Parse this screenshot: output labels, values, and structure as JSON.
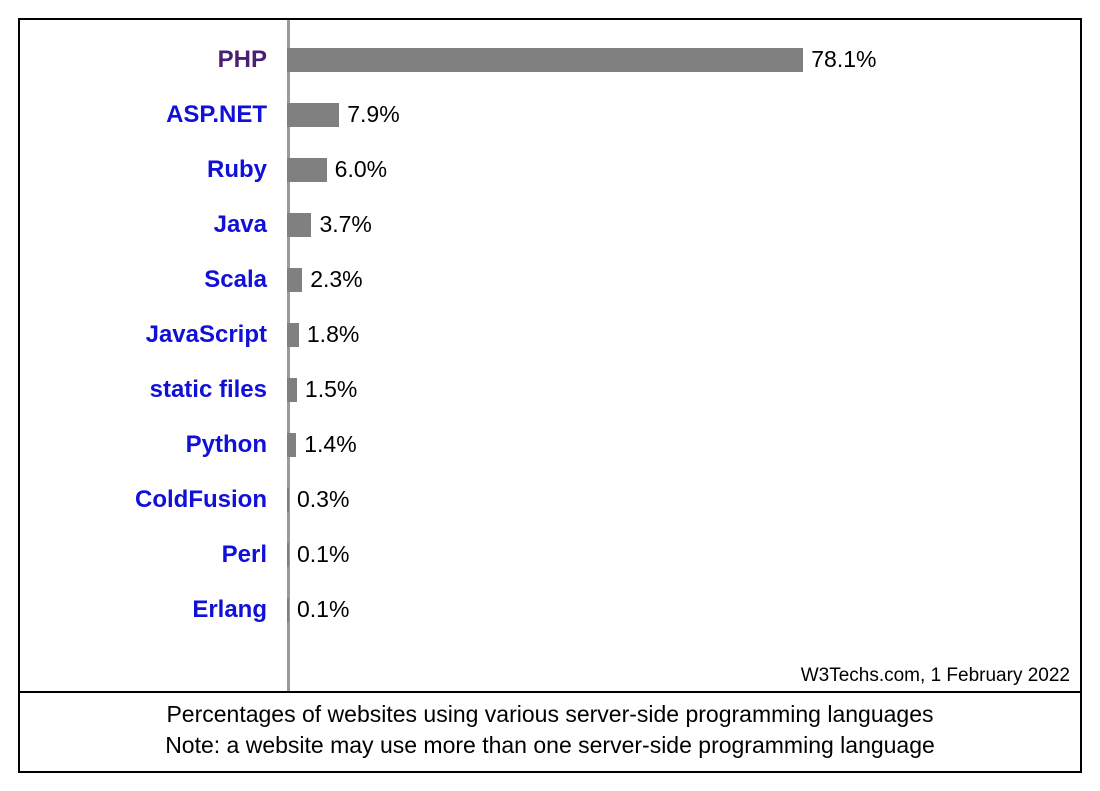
{
  "chart_data": {
    "type": "bar",
    "orientation": "horizontal",
    "categories": [
      "PHP",
      "ASP.NET",
      "Ruby",
      "Java",
      "Scala",
      "JavaScript",
      "static files",
      "Python",
      "ColdFusion",
      "Perl",
      "Erlang"
    ],
    "values": [
      78.1,
      7.9,
      6.0,
      3.7,
      2.3,
      1.8,
      1.5,
      1.4,
      0.3,
      0.1,
      0.1
    ],
    "value_suffix": "%",
    "xlim": [
      0,
      100
    ],
    "highlighted_index": 0,
    "bar_color": "#808080",
    "label_color": "#1010d8",
    "highlight_label_color": "#4b1f6f"
  },
  "source_line": "W3Techs.com, 1 February 2022",
  "caption_line1": "Percentages of websites using various server-side programming languages",
  "caption_line2": "Note: a website may use more than one server-side programming language"
}
